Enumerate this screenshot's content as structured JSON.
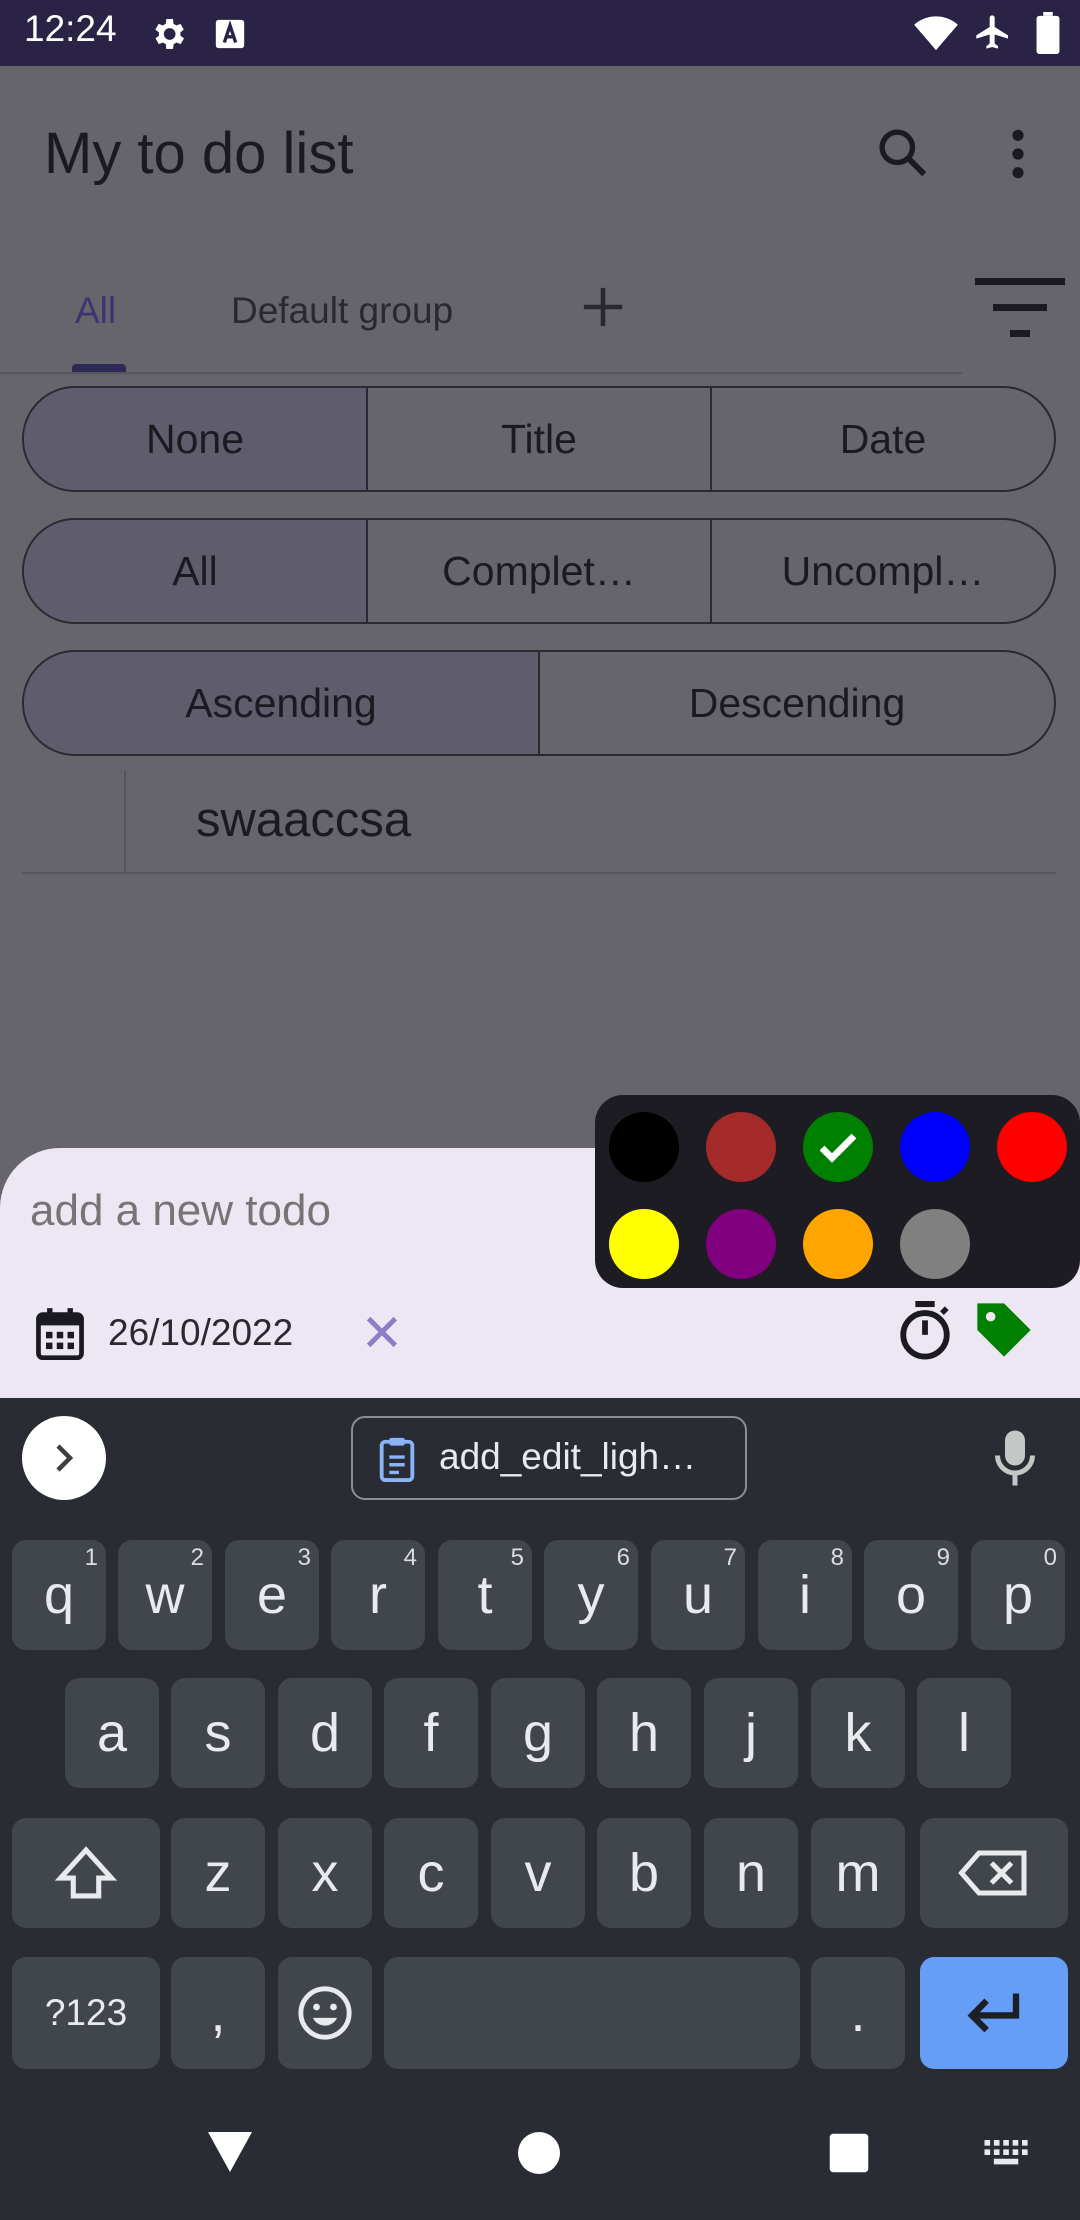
{
  "status_bar": {
    "time": "12:24"
  },
  "app_bar": {
    "title": "My to do list"
  },
  "tabs": [
    {
      "label": "All"
    },
    {
      "label": "Default group"
    }
  ],
  "sort_by": {
    "options": [
      "None",
      "Title",
      "Date"
    ],
    "selected": "None"
  },
  "filter": {
    "options": [
      "All",
      "Complet…",
      "Uncompl…"
    ],
    "selected": "All"
  },
  "order": {
    "options": [
      "Ascending",
      "Descending"
    ],
    "selected": "Ascending"
  },
  "todo_items": [
    {
      "title": "swaaccsa"
    }
  ],
  "new_todo": {
    "placeholder": "add a new todo",
    "date": "26/10/2022"
  },
  "color_picker": {
    "colors": [
      "#000000",
      "#a52a2a",
      "#008000",
      "#0000ff",
      "#ff0000",
      "#ffff00",
      "#800080",
      "#ffa500",
      "#808080"
    ],
    "selected": "#008000"
  },
  "keyboard": {
    "suggestion": "add_edit_ligh…",
    "row1": [
      "q",
      "w",
      "e",
      "r",
      "t",
      "y",
      "u",
      "i",
      "o",
      "p"
    ],
    "row1_hints": [
      "1",
      "2",
      "3",
      "4",
      "5",
      "6",
      "7",
      "8",
      "9",
      "0"
    ],
    "row2": [
      "a",
      "s",
      "d",
      "f",
      "g",
      "h",
      "j",
      "k",
      "l"
    ],
    "row3": [
      "z",
      "x",
      "c",
      "v",
      "b",
      "n",
      "m"
    ],
    "symbols_key": "?123",
    "comma_key": ",",
    "period_key": "."
  },
  "accent_color": "#6750a4",
  "tag_color": "#008000"
}
